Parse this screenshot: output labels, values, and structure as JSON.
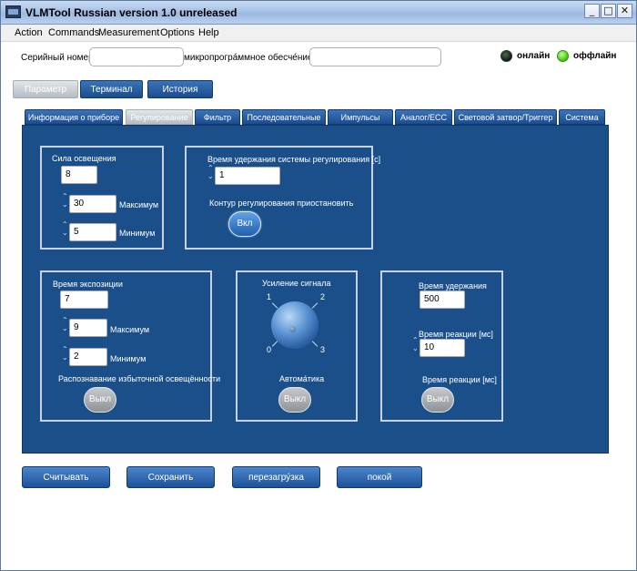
{
  "window": {
    "title": "VLMTool   Russian version 1.0 unreleased",
    "min": "_",
    "max": "□",
    "close": "✕"
  },
  "menu": [
    "Action",
    "Commands",
    "Measurement",
    "Options",
    "Help"
  ],
  "header": {
    "serial_label": "Серийный номер",
    "serial_value": "",
    "firmware_label": "микропрогра́ммное обесче́ние",
    "firmware_value": "",
    "online_label": "онлайн",
    "offline_label": "оффлайн"
  },
  "top_tabs": [
    "Параметр",
    "Терминал",
    "История"
  ],
  "sub_tabs": [
    "Информация о приборе",
    "Регулирование",
    "Фильтр",
    "Последовательные",
    "Импульсы",
    "Аналог/ECC",
    "Световой затвор/Триггер",
    "Система"
  ],
  "illum": {
    "title": "Сила освещения",
    "value": "8",
    "max_value": "30",
    "max_label": "Максимум",
    "min_value": "5",
    "min_label": "Минимум"
  },
  "hold": {
    "title": "Время удержания системы регулирования [с]",
    "value": "1",
    "pause_label": "Контур регулирования приостановить",
    "pause_button": "Вкл"
  },
  "exposure": {
    "title": "Время экспозиции",
    "value": "7",
    "max_value": "9",
    "max_label": "Максимум",
    "min_value": "2",
    "min_label": "Минимум",
    "detect_label": "Распознавание избыточной освещённости",
    "detect_button": "Выкл"
  },
  "gain": {
    "title": "Усиление сигнала",
    "knob_labels": [
      "0",
      "1",
      "2",
      "3"
    ],
    "auto_label": "Автома́тика",
    "auto_button": "Выкл"
  },
  "timing": {
    "hold_label": "Время удержания",
    "hold_value": "500",
    "react_label": "Время реакции [мс]",
    "react_value": "10",
    "react2_label": "Время реакции [мс]",
    "react_button": "Выкл"
  },
  "buttons": [
    "Считывать",
    "Сохранить",
    "перезагру́зка",
    "покой"
  ]
}
